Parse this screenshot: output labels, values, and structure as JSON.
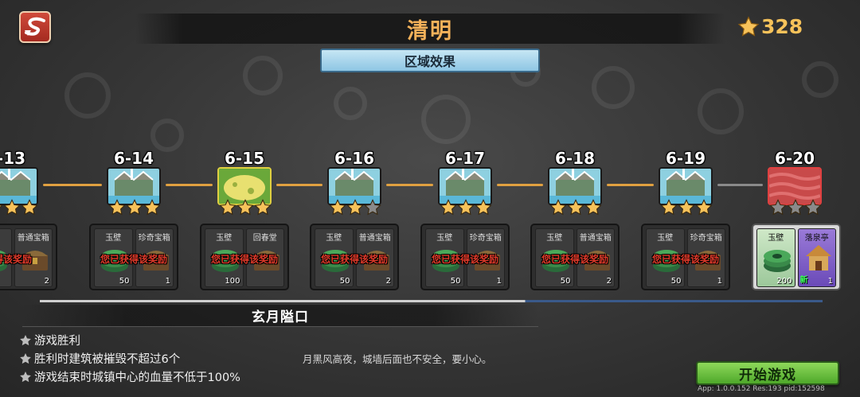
{
  "header": {
    "title": "清明",
    "star_total": "328",
    "zone_effect_label": "区域效果"
  },
  "levels": [
    {
      "id": "-13",
      "stars": 3,
      "state": "locked-done",
      "rewards": [
        {
          "name": "",
          "count": ""
        },
        {
          "name": "普通宝箱",
          "count": "2"
        }
      ],
      "obtained": "得该奖励"
    },
    {
      "id": "6-14",
      "stars": 3,
      "rewards": [
        {
          "name": "玉壁",
          "count": "50"
        },
        {
          "name": "珍奇宝箱",
          "count": "1"
        }
      ],
      "obtained": "您已获得该奖励"
    },
    {
      "id": "6-15",
      "stars": 3,
      "rewards": [
        {
          "name": "玉壁",
          "count": "100"
        },
        {
          "name": "回春堂",
          "count": ""
        }
      ],
      "obtained": "您已获得该奖励"
    },
    {
      "id": "6-16",
      "stars": 2,
      "rewards": [
        {
          "name": "玉壁",
          "count": "50"
        },
        {
          "name": "普通宝箱",
          "count": "2"
        }
      ],
      "obtained": "您已获得该奖励"
    },
    {
      "id": "6-17",
      "stars": 3,
      "rewards": [
        {
          "name": "玉壁",
          "count": "50"
        },
        {
          "name": "珍奇宝箱",
          "count": "1"
        }
      ],
      "obtained": "您已获得该奖励"
    },
    {
      "id": "6-18",
      "stars": 3,
      "rewards": [
        {
          "name": "玉壁",
          "count": "50"
        },
        {
          "name": "普通宝箱",
          "count": "2"
        }
      ],
      "obtained": "您已获得该奖励"
    },
    {
      "id": "6-19",
      "stars": 3,
      "rewards": [
        {
          "name": "玉壁",
          "count": "50"
        },
        {
          "name": "珍奇宝箱",
          "count": "1"
        }
      ],
      "obtained": "您已获得该奖励"
    },
    {
      "id": "6-20",
      "stars": 0,
      "rewards": [
        {
          "name": "玉壁",
          "count": "200"
        },
        {
          "name": "落泉亭",
          "count": "1",
          "badge": "新"
        }
      ],
      "obtained": ""
    }
  ],
  "zone": {
    "name": "玄月隘口",
    "objectives": [
      "游戏胜利",
      "胜利时建筑被摧毁不超过6个",
      "游戏结束时城镇中心的血量不低于100%"
    ],
    "flavor": "月黑风高夜，城墙后面也不安全，要小心。"
  },
  "start_button": "开始游戏",
  "version": "App: 1.0.0.152 Res:193 pid:152598",
  "colors": {
    "title": "#f4b25a",
    "star": "#f6c25a",
    "obtained": "#e23a2a",
    "start": "#6ec040"
  }
}
